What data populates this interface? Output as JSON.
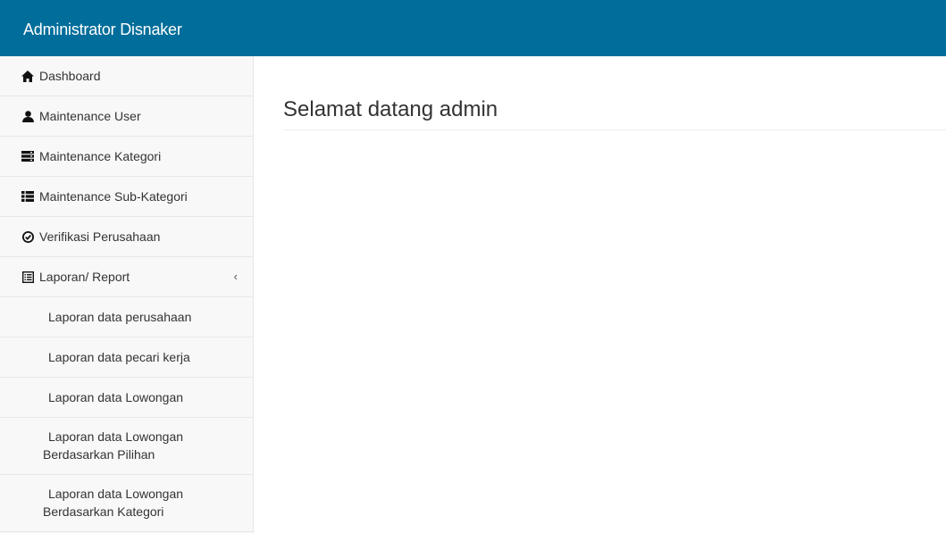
{
  "header": {
    "brand": "Administrator Disnaker"
  },
  "sidebar": {
    "items": [
      {
        "label": "Dashboard",
        "icon": "home-icon"
      },
      {
        "label": "Maintenance User",
        "icon": "user-icon"
      },
      {
        "label": "Maintenance Kategori",
        "icon": "server-icon"
      },
      {
        "label": "Maintenance Sub-Kategori",
        "icon": "th-list-icon"
      },
      {
        "label": "Verifikasi Perusahaan",
        "icon": "ok-circle-icon"
      },
      {
        "label": "Laporan/ Report",
        "icon": "list-alt-icon",
        "expanded": true
      }
    ],
    "chevron": "‹",
    "report_sub_items": [
      {
        "label": "Laporan data perusahaan"
      },
      {
        "label": "Laporan data pecari kerja"
      },
      {
        "label": "Laporan data Lowongan"
      },
      {
        "line1": "Laporan data Lowongan",
        "line2": "Berdasarkan Pilihan"
      },
      {
        "line1": "Laporan data Lowongan",
        "line2": "Berdasarkan Kategori"
      }
    ]
  },
  "main": {
    "title": "Selamat datang admin"
  },
  "colors": {
    "navbar": "#006d9a",
    "sidebar_bg": "#f8f8f8",
    "divider": "#e7e7e7"
  }
}
